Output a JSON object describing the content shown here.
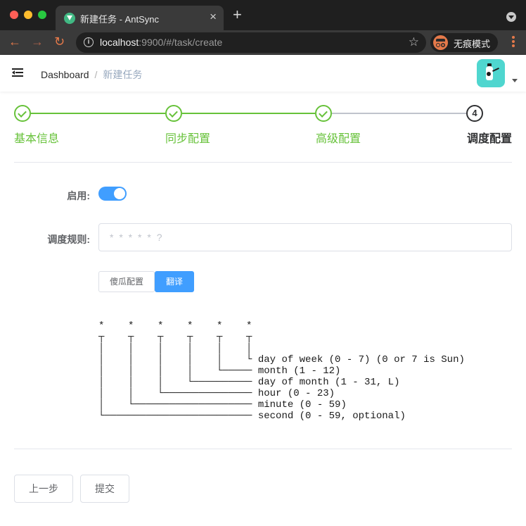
{
  "browser": {
    "tab_title": "新建任务 - AntSync",
    "url_host": "localhost",
    "url_rest": ":9900/#/task/create",
    "incognito_label": "无痕模式",
    "icons": [
      "close-icon",
      "plus-icon",
      "back-icon",
      "forward-icon",
      "reload-icon",
      "info-icon",
      "star-icon",
      "incognito-icon",
      "more-icon"
    ]
  },
  "header": {
    "breadcrumb_home": "Dashboard",
    "breadcrumb_separator": "/",
    "breadcrumb_current": "新建任务"
  },
  "steps": [
    {
      "title": "基本信息",
      "status": "finished"
    },
    {
      "title": "同步配置",
      "status": "finished"
    },
    {
      "title": "高级配置",
      "status": "finished"
    },
    {
      "title": "调度配置",
      "status": "current",
      "number": "4"
    }
  ],
  "form": {
    "enable_label": "启用:",
    "enable_value": true,
    "rule_label": "调度规则:",
    "rule_value": "",
    "rule_placeholder": "* * * * * ?",
    "preset_button": "傻瓜配置",
    "translate_button": "翻译"
  },
  "cron_diagram": {
    "lines": [
      "*    *    *    *    *    *",
      "┬    ┬    ┬    ┬    ┬    ┬",
      "│    │    │    │    │    │",
      "│    │    │    │    │    └ day of week (0 - 7) (0 or 7 is Sun)",
      "│    │    │    │    └───── month (1 - 12)",
      "│    │    │    └────────── day of month (1 - 31, L)",
      "│    │    └─────────────── hour (0 - 23)",
      "│    └──────────────────── minute (0 - 59)",
      "└───────────────────────── second (0 - 59, optional)"
    ]
  },
  "footer": {
    "prev_button": "上一步",
    "submit_button": "提交"
  },
  "colors": {
    "success": "#67c23a",
    "primary": "#409eff",
    "chrome_dark": "#1f1f1f",
    "accent_orange": "#e4794a"
  }
}
